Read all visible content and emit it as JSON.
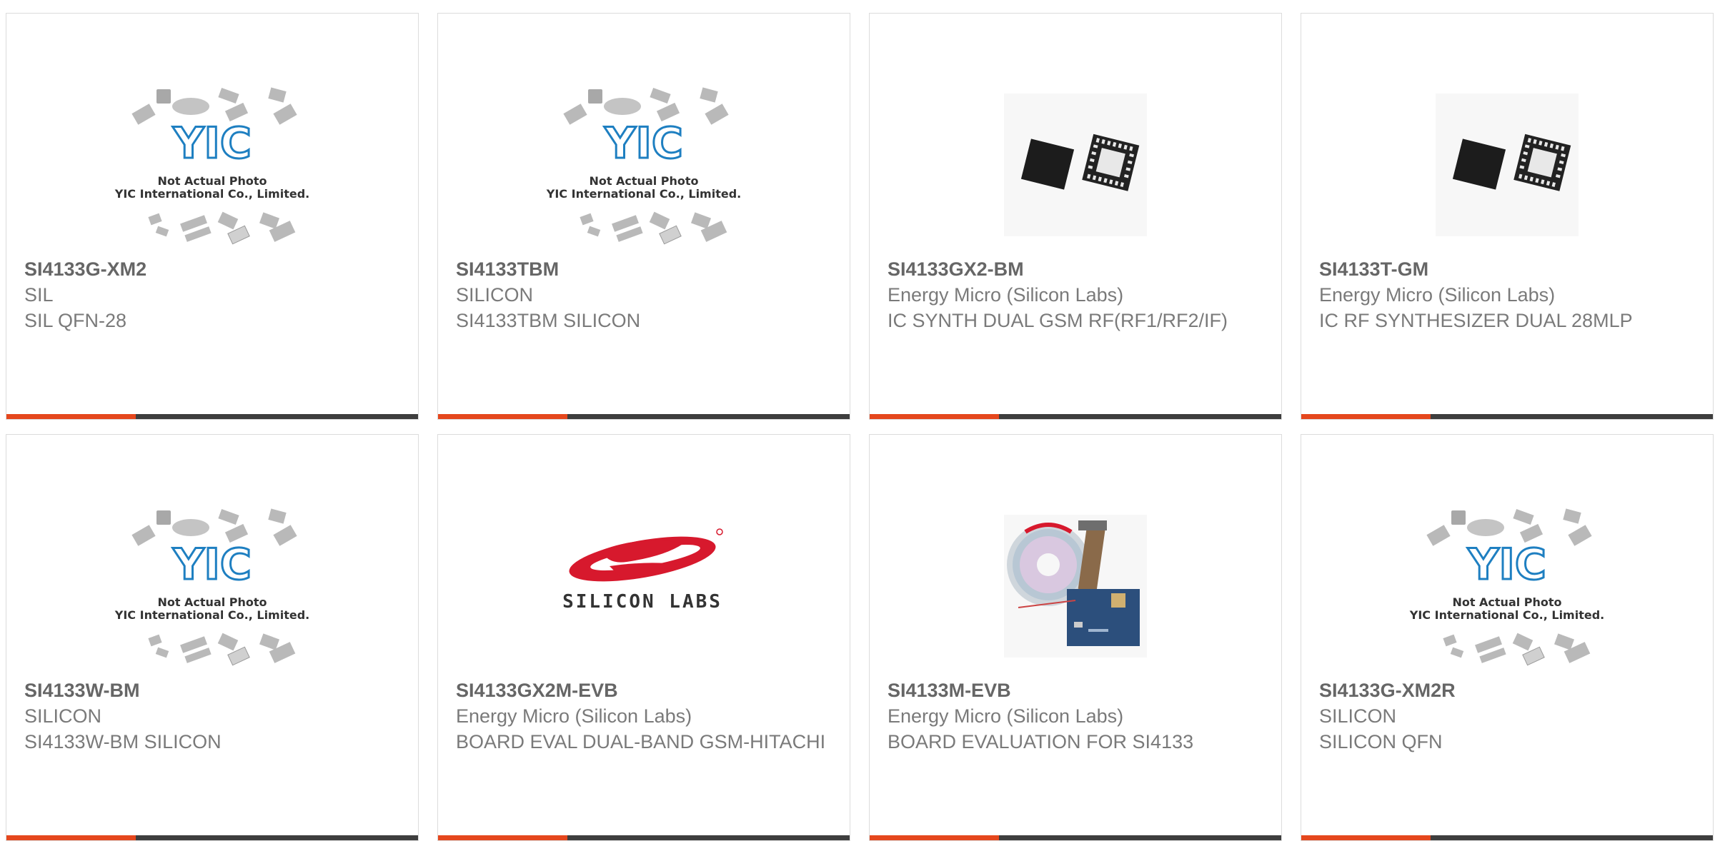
{
  "products": [
    {
      "part": "SI4133G-XM2",
      "manufacturer": "SIL",
      "description": "SIL QFN-28",
      "image": "placeholder"
    },
    {
      "part": "SI4133TBM",
      "manufacturer": "SILICON",
      "description": "SI4133TBM SILICON",
      "image": "placeholder"
    },
    {
      "part": "SI4133GX2-BM",
      "manufacturer": "Energy Micro (Silicon Labs)",
      "description": "IC SYNTH DUAL GSM RF(RF1/RF2/IF)",
      "image": "chip-photo"
    },
    {
      "part": "SI4133T-GM",
      "manufacturer": "Energy Micro (Silicon Labs)",
      "description": "IC RF SYNTHESIZER DUAL 28MLP",
      "image": "chip-photo"
    },
    {
      "part": "SI4133W-BM",
      "manufacturer": "SILICON",
      "description": "SI4133W-BM SILICON",
      "image": "placeholder"
    },
    {
      "part": "SI4133GX2M-EVB",
      "manufacturer": "Energy Micro (Silicon Labs)",
      "description": "BOARD EVAL DUAL-BAND GSM-HITACHI",
      "image": "silicon-labs-logo"
    },
    {
      "part": "SI4133M-EVB",
      "manufacturer": "Energy Micro (Silicon Labs)",
      "description": "BOARD EVALUATION FOR SI4133",
      "image": "eval-board-photo"
    },
    {
      "part": "SI4133G-XM2R",
      "manufacturer": "SILICON",
      "description": "SILICON QFN",
      "image": "placeholder"
    }
  ],
  "placeholder": {
    "brand": "YIC",
    "line1": "Not Actual Photo",
    "line2": "YIC International Co., Limited."
  },
  "logo_text": "SILICON LABS",
  "colors": {
    "accent": "#e5471d",
    "bar": "#3e3e3e",
    "yic_blue": "#1e7fc1",
    "silabs_red": "#d7192d"
  }
}
